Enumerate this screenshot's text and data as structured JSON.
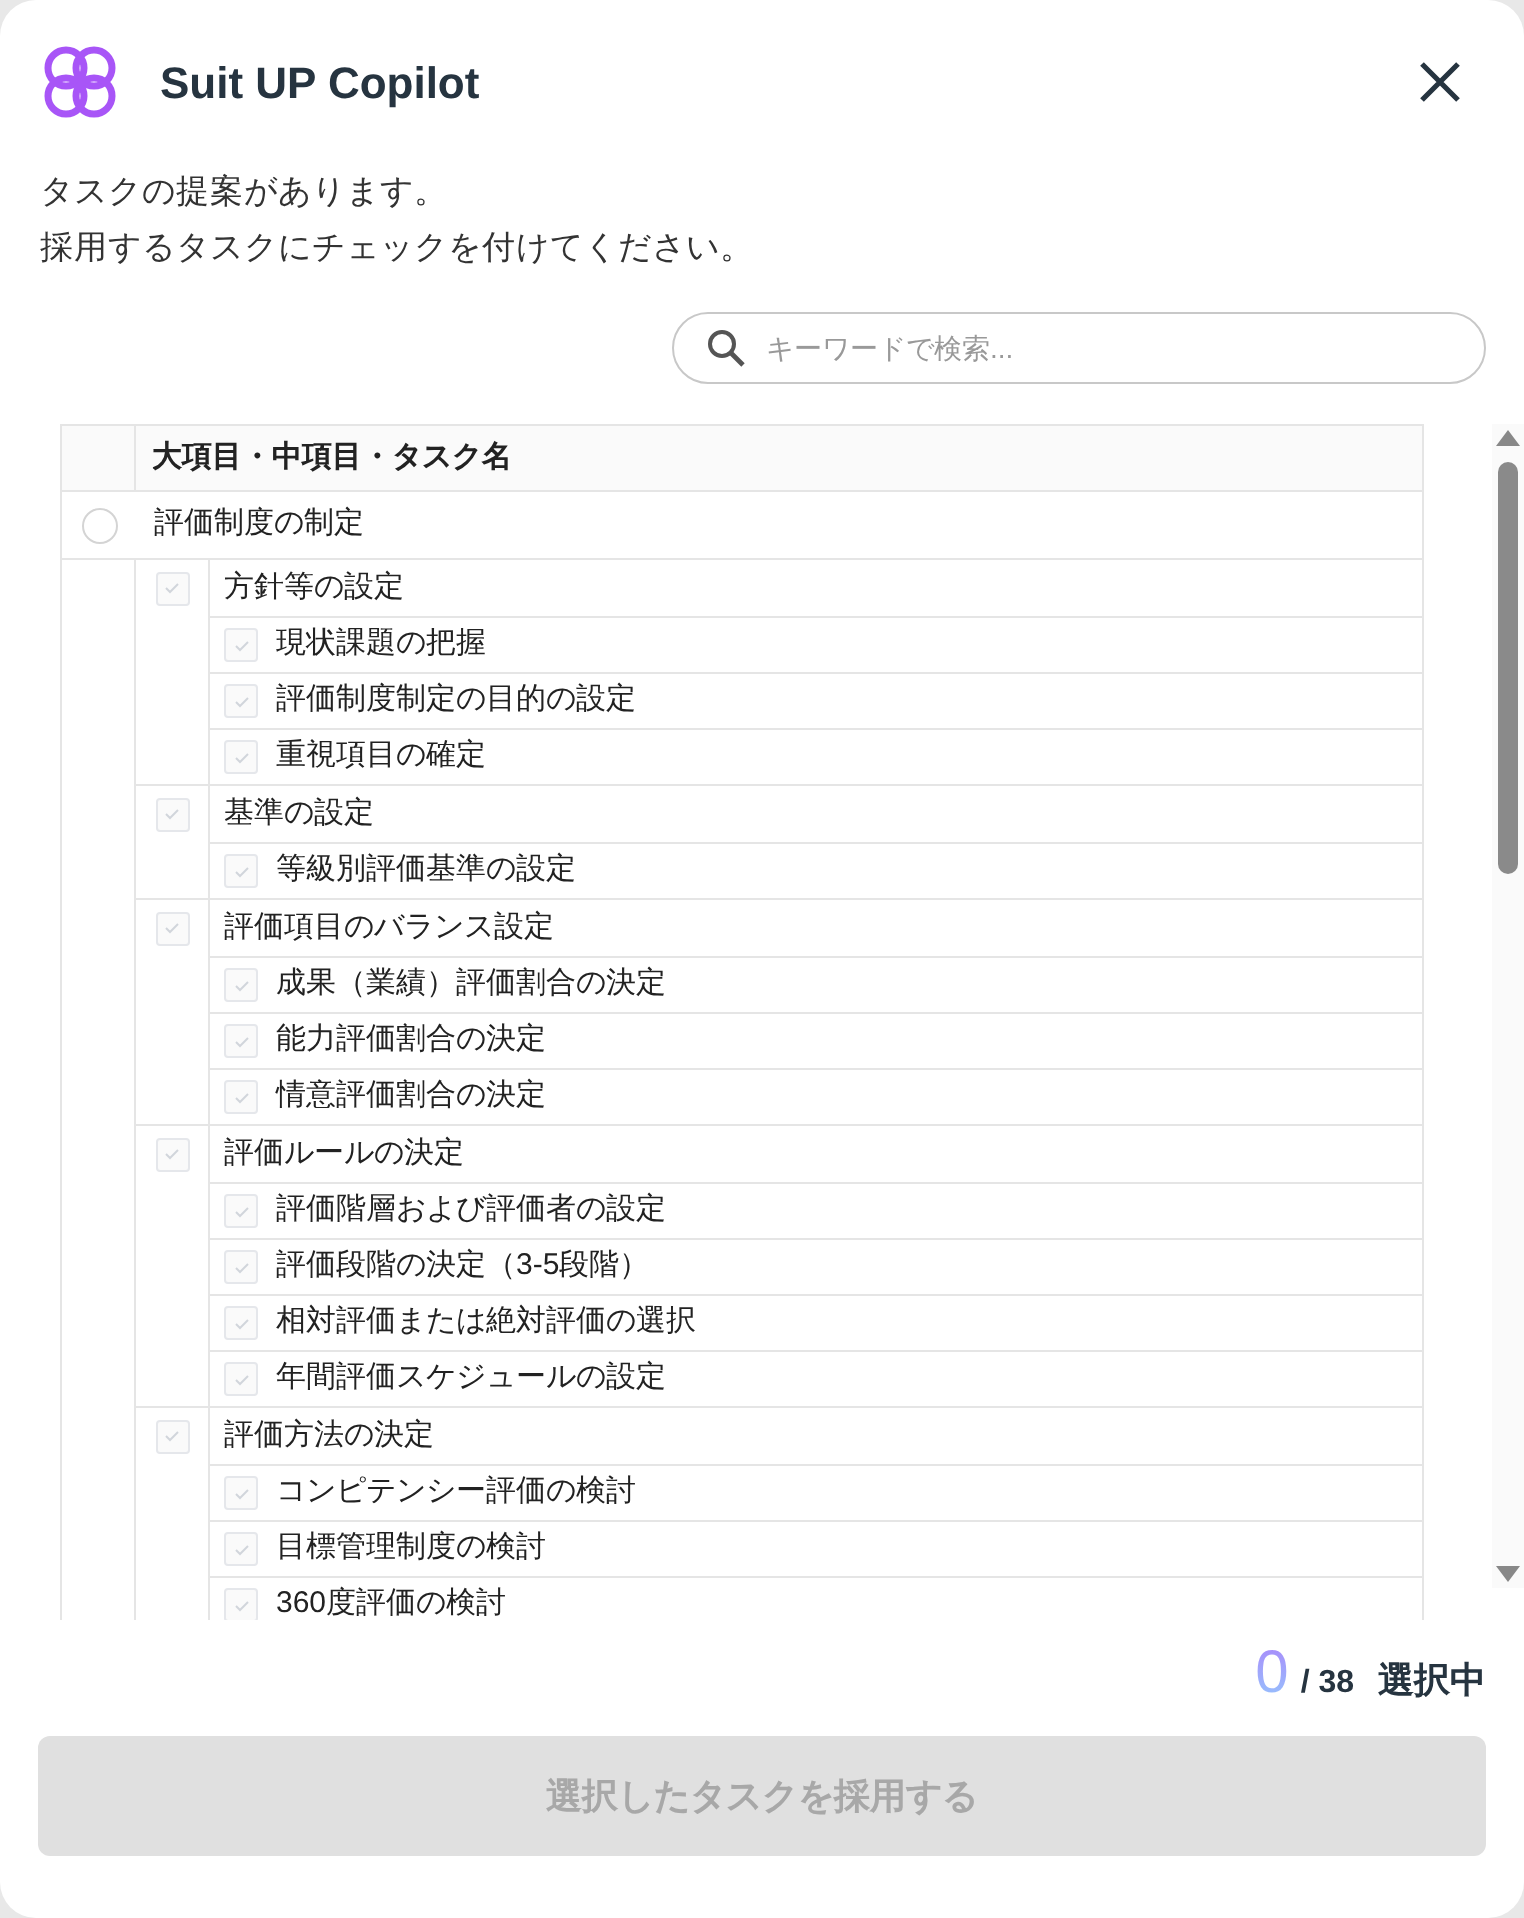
{
  "app": {
    "title": "Suit UP Copilot"
  },
  "message": [
    "タスクの提案があります。",
    "採用するタスクにチェックを付けてください。"
  ],
  "search": {
    "placeholder": "キーワードで検索..."
  },
  "table": {
    "columns": [
      "大項目・中項目・タスク名"
    ],
    "rows": [
      {
        "label": "評価制度の制定",
        "checked": false,
        "children": [
          {
            "label": "方針等の設定",
            "checked": false,
            "disabled": true,
            "children": [
              {
                "label": "現状課題の把握",
                "checked": false,
                "disabled": true
              },
              {
                "label": "評価制度制定の目的の設定",
                "checked": false,
                "disabled": true
              },
              {
                "label": "重視項目の確定",
                "checked": false,
                "disabled": true
              }
            ]
          },
          {
            "label": "基準の設定",
            "checked": false,
            "disabled": true,
            "children": [
              {
                "label": "等級別評価基準の設定",
                "checked": false,
                "disabled": true
              }
            ]
          },
          {
            "label": "評価項目のバランス設定",
            "checked": false,
            "disabled": true,
            "children": [
              {
                "label": "成果（業績）評価割合の決定",
                "checked": false,
                "disabled": true
              },
              {
                "label": "能力評価割合の決定",
                "checked": false,
                "disabled": true
              },
              {
                "label": "情意評価割合の決定",
                "checked": false,
                "disabled": true
              }
            ]
          },
          {
            "label": "評価ルールの決定",
            "checked": false,
            "disabled": true,
            "children": [
              {
                "label": "評価階層および評価者の設定",
                "checked": false,
                "disabled": true
              },
              {
                "label": "評価段階の決定（3-5段階）",
                "checked": false,
                "disabled": true
              },
              {
                "label": "相対評価または絶対評価の選択",
                "checked": false,
                "disabled": true
              },
              {
                "label": "年間評価スケジュールの設定",
                "checked": false,
                "disabled": true
              }
            ]
          },
          {
            "label": "評価方法の決定",
            "checked": false,
            "disabled": true,
            "children": [
              {
                "label": "コンピテンシー評価の検討",
                "checked": false,
                "disabled": true
              },
              {
                "label": "目標管理制度の検討",
                "checked": false,
                "disabled": true
              },
              {
                "label": "360度評価の検討",
                "checked": false,
                "disabled": true
              }
            ]
          }
        ]
      }
    ]
  },
  "selection": {
    "count": "0",
    "total": "/ 38",
    "label": "選択中"
  },
  "submit": {
    "label": "選択したタスクを採用する",
    "disabled": true
  }
}
